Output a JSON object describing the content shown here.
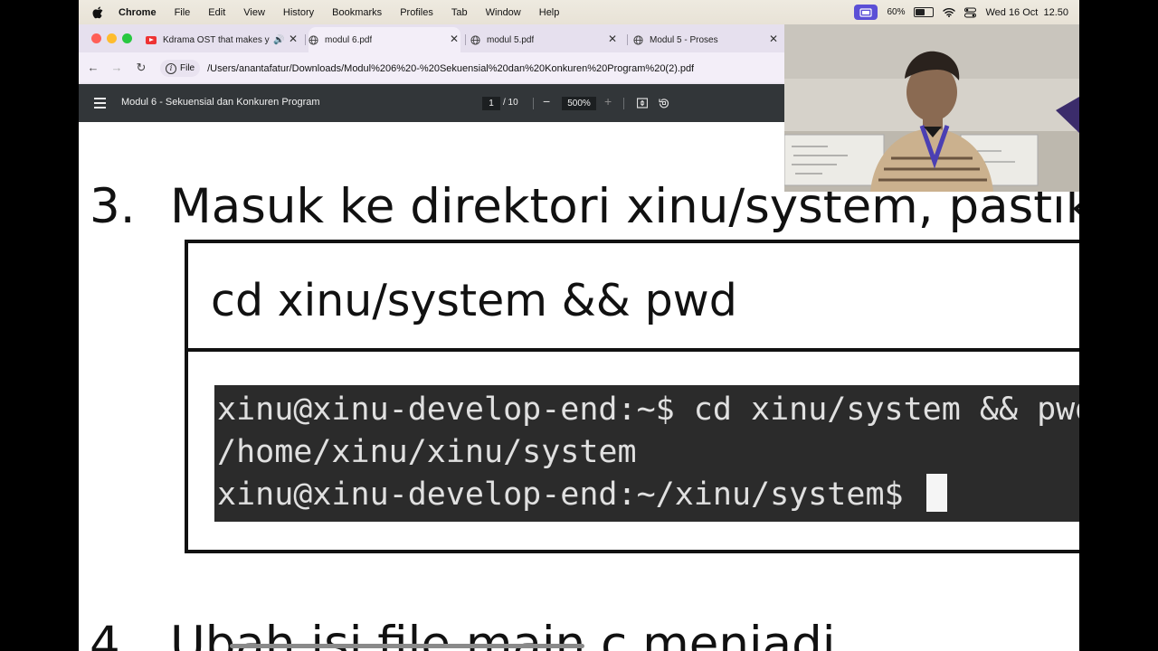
{
  "menubar": {
    "app": "Chrome",
    "items": [
      "File",
      "Edit",
      "View",
      "History",
      "Bookmarks",
      "Profiles",
      "Tab",
      "Window",
      "Help"
    ],
    "battery": "60%",
    "battery_level": 0.6,
    "datetime": "Wed 16 Oct  12.50"
  },
  "tabs": [
    {
      "title": "Kdrama OST that makes y",
      "icon": "youtube-icon",
      "audio": true
    },
    {
      "title": "modul 6.pdf",
      "icon": "globe-icon"
    },
    {
      "title": "modul 5.pdf",
      "icon": "globe-icon"
    },
    {
      "title": "Modul 5 - Proses",
      "icon": "globe-icon"
    }
  ],
  "omnibox": {
    "chip": "File",
    "url": "/Users/anantafatur/Downloads/Modul%206%20-%20Sekuensial%20dan%20Konkuren%20Program%20(2).pdf"
  },
  "pdf": {
    "title": "Modul 6 - Sekuensial dan Konkuren Program",
    "page_current": "1",
    "page_total": "/ 10",
    "zoom": "500%"
  },
  "content": {
    "step3_num": "3.",
    "step3_text": "Masuk ke direktori xinu/system, pastikan",
    "command": "cd xinu/system && pwd",
    "terminal_lines": [
      "xinu@xinu-develop-end:~$ cd xinu/system && pwd",
      "/home/xinu/xinu/system",
      "xinu@xinu-develop-end:~/xinu/system$ "
    ],
    "step4_num": "4.",
    "step4_text": "Ubah isi file main.c menjadi"
  },
  "colors": {
    "pdf_toolbar": "#323639",
    "tab_strip": "#e6e0ee",
    "terminal_bg": "#2b2b2b",
    "close_light": "#ff5f57",
    "min_light": "#febc2e",
    "max_light": "#28c840"
  }
}
